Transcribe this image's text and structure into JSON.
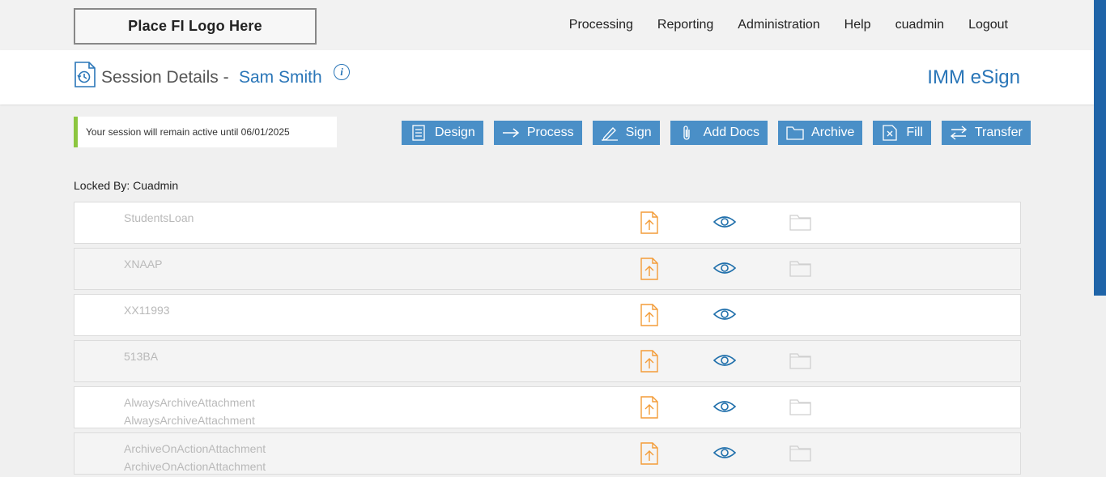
{
  "logo": {
    "text": "Place FI Logo Here"
  },
  "nav": {
    "items": [
      "Processing",
      "Reporting",
      "Administration",
      "Help",
      "cuadmin",
      "Logout"
    ]
  },
  "header": {
    "title": "Session Details -",
    "customer_name": "Sam Smith",
    "info_glyph": "i",
    "brand": "IMM eSign"
  },
  "notice": {
    "text": "Your session will remain active until 06/01/2025",
    "accent_color": "#8cc63f"
  },
  "actions": [
    {
      "label": "Design",
      "icon": "design-icon"
    },
    {
      "label": "Process",
      "icon": "arrow-right-icon"
    },
    {
      "label": "Sign",
      "icon": "pen-icon"
    },
    {
      "label": "Add Docs",
      "icon": "paperclip-icon"
    },
    {
      "label": "Archive",
      "icon": "folder-icon"
    },
    {
      "label": "Fill",
      "icon": "fill-doc-icon"
    },
    {
      "label": "Transfer",
      "icon": "transfer-icon"
    }
  ],
  "locked_by": "Locked By: Cuadmin",
  "documents": [
    {
      "names": [
        "StudentsLoan"
      ],
      "has_folder": true
    },
    {
      "names": [
        "XNAAP"
      ],
      "has_folder": true
    },
    {
      "names": [
        "XX11993"
      ],
      "has_folder": false
    },
    {
      "names": [
        "513BA"
      ],
      "has_folder": true
    },
    {
      "names": [
        "AlwaysArchiveAttachment",
        "AlwaysArchiveAttachment"
      ],
      "has_folder": true
    },
    {
      "names": [
        "ArchiveOnActionAttachment",
        "ArchiveOnActionAttachment"
      ],
      "has_folder": true
    }
  ],
  "colors": {
    "accent": "#2a76b8",
    "button": "#4a8fc7",
    "upload_icon": "#f39c38",
    "eye_icon": "#1f6fab"
  }
}
